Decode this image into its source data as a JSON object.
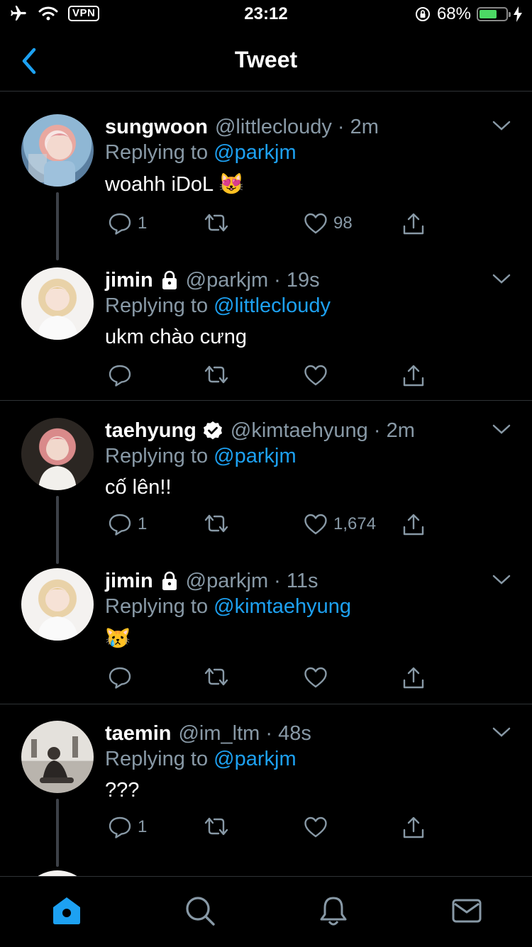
{
  "status_bar": {
    "time": "23:12",
    "vpn": "VPN",
    "battery_percent": "68%",
    "battery_level": 0.68
  },
  "nav": {
    "title": "Tweet"
  },
  "tweets": [
    {
      "name": "sungwoon",
      "handle": "@littlecloudy",
      "time": "2m",
      "reply_prefix": "Replying to",
      "reply_to": "@parkjm",
      "text": "woahh iDoL 😻",
      "replies": "1",
      "likes": "98",
      "locked": false,
      "verified": false
    },
    {
      "name": "jimin",
      "handle": "@parkjm",
      "time": "19s",
      "reply_prefix": "Replying to",
      "reply_to": "@littlecloudy",
      "text": "ukm chào cưng",
      "replies": "",
      "likes": "",
      "locked": true,
      "verified": false
    },
    {
      "name": "taehyung",
      "handle": "@kimtaehyung",
      "time": "2m",
      "reply_prefix": "Replying to",
      "reply_to": "@parkjm",
      "text": "cố lên!!",
      "replies": "1",
      "likes": "1,674",
      "locked": false,
      "verified": true
    },
    {
      "name": "jimin",
      "handle": "@parkjm",
      "time": "11s",
      "reply_prefix": "Replying to",
      "reply_to": "@kimtaehyung",
      "text": "😿",
      "replies": "",
      "likes": "",
      "locked": true,
      "verified": false
    },
    {
      "name": "taemin",
      "handle": "@im_ltm",
      "time": "48s",
      "reply_prefix": "Replying to",
      "reply_to": "@parkjm",
      "text": "???",
      "replies": "1",
      "likes": "",
      "locked": false,
      "verified": false
    }
  ],
  "tabs": [
    "home-icon",
    "search-icon",
    "notifications-icon",
    "messages-icon"
  ],
  "colors": {
    "accent": "#1da1f2",
    "muted": "#8899a6",
    "background": "#000000",
    "battery": "#4cd964"
  }
}
